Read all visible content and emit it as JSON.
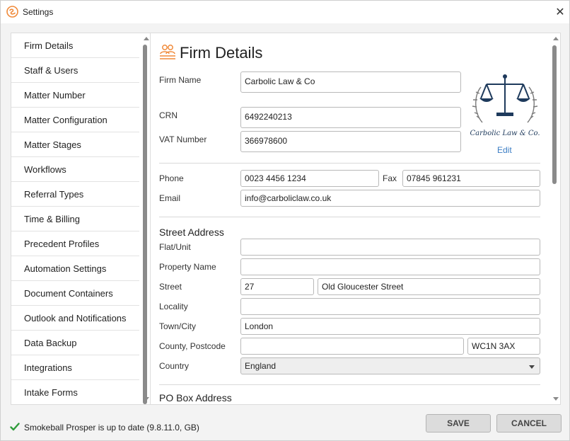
{
  "window": {
    "title": "Settings",
    "close_glyph": "✕"
  },
  "sidebar": {
    "items": [
      {
        "label": "Firm Details"
      },
      {
        "label": "Staff & Users"
      },
      {
        "label": "Matter Number"
      },
      {
        "label": "Matter Configuration"
      },
      {
        "label": "Matter Stages"
      },
      {
        "label": "Workflows"
      },
      {
        "label": "Referral Types"
      },
      {
        "label": "Time & Billing"
      },
      {
        "label": "Precedent Profiles"
      },
      {
        "label": "Automation Settings"
      },
      {
        "label": "Document Containers"
      },
      {
        "label": "Outlook and Notifications"
      },
      {
        "label": "Data Backup"
      },
      {
        "label": "Integrations"
      },
      {
        "label": "Intake Forms"
      }
    ],
    "active_index": 0
  },
  "main": {
    "title": "Firm Details",
    "heading_icon": "users-icon",
    "firm": {
      "firm_name_label": "Firm Name",
      "firm_name": "Carbolic Law & Co",
      "crn_label": "CRN",
      "crn": "6492240213",
      "vat_label": "VAT Number",
      "vat": "366978600"
    },
    "logo": {
      "icon": "scales-of-justice-logo",
      "text": "Carbolic Law & Co.",
      "edit_label": "Edit"
    },
    "contact": {
      "phone_label": "Phone",
      "phone": "0023 4456 1234",
      "fax_label": "Fax",
      "fax": "07845 961231",
      "email_label": "Email",
      "email": "info@carboliclaw.co.uk"
    },
    "street_address": {
      "section_title": "Street Address",
      "flat_label": "Flat/Unit",
      "flat": "",
      "property_label": "Property Name",
      "property": "",
      "street_label": "Street",
      "street_number": "27",
      "street_name": "Old Gloucester Street",
      "locality_label": "Locality",
      "locality": "",
      "town_label": "Town/City",
      "town": "London",
      "county_label": "County, Postcode",
      "county": "",
      "postcode": "WC1N 3AX",
      "country_label": "Country",
      "country": "England"
    },
    "next_section_partial": "PO Box Address"
  },
  "footer": {
    "status_text": "Smokeball Prosper is up to date (9.8.11.0, GB)",
    "status_icon": "check-icon",
    "save_label": "SAVE",
    "cancel_label": "CANCEL"
  },
  "colors": {
    "accent_orange": "#f08a3a",
    "link_blue": "#3b7dc4",
    "status_green": "#2e9b3a",
    "logo_navy": "#1e3a5c"
  }
}
